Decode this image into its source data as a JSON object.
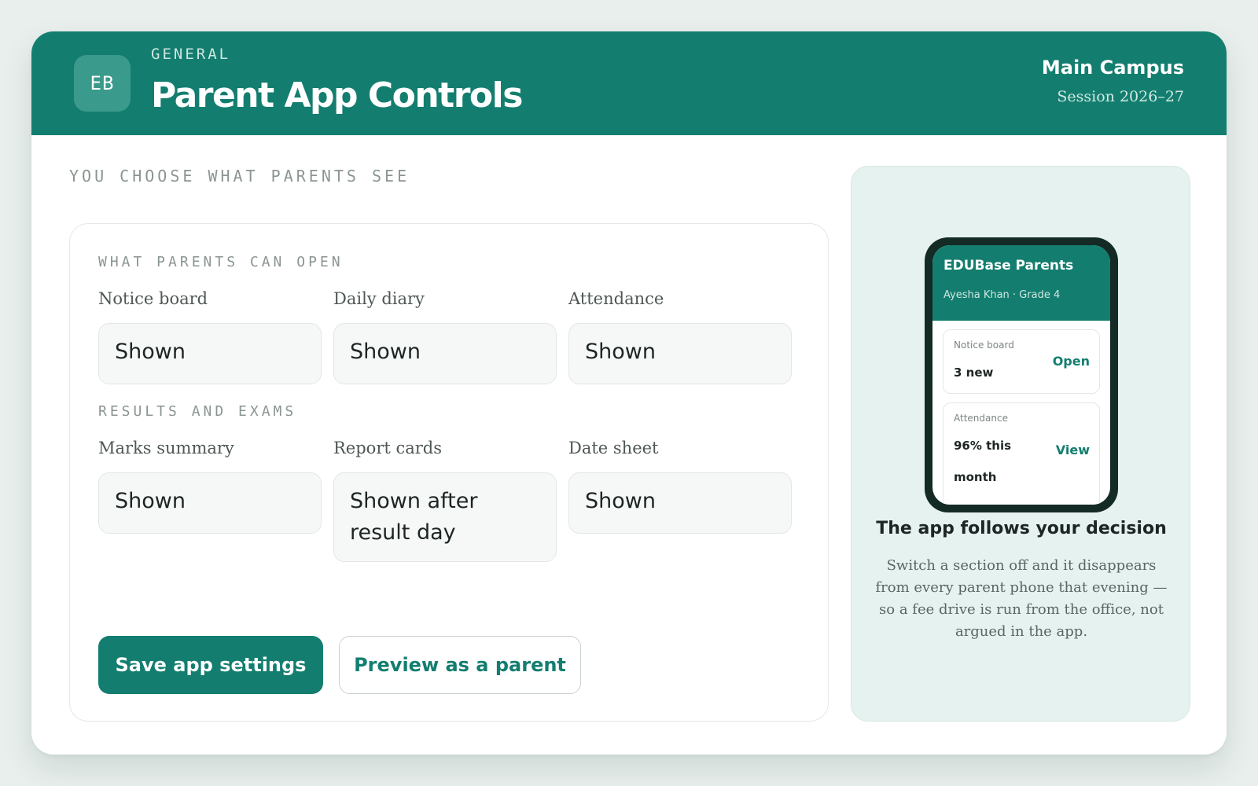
{
  "header": {
    "logo_initials": "EB",
    "eyebrow": "GENERAL",
    "title": "Parent App Controls",
    "campus": "Main Campus",
    "session": "Session 2026–27"
  },
  "main": {
    "kicker": "YOU CHOOSE WHAT PARENTS SEE",
    "sections": [
      {
        "label": "WHAT PARENTS CAN OPEN",
        "fields": [
          {
            "label": "Notice board",
            "value": "Shown"
          },
          {
            "label": "Daily diary",
            "value": "Shown"
          },
          {
            "label": "Attendance",
            "value": "Shown"
          }
        ]
      },
      {
        "label": "RESULTS AND EXAMS",
        "fields": [
          {
            "label": "Marks summary",
            "value": "Shown"
          },
          {
            "label": "Report cards",
            "value": "Shown after result day"
          },
          {
            "label": "Date sheet",
            "value": "Shown"
          }
        ]
      }
    ],
    "save_label": "Save app settings",
    "preview_label": "Preview as a parent"
  },
  "preview": {
    "app_name": "EDUBase Parents",
    "student": "Ayesha Khan · Grade 4",
    "cards": [
      {
        "label": "Notice board",
        "value": "3 new",
        "action": "Open"
      },
      {
        "label": "Attendance",
        "value": "96% this month",
        "action": "View"
      }
    ],
    "title": "The app follows your decision",
    "body": "Switch a section off and it disappears from every parent phone that evening — so a fee drive is run from the office, not argued in the app."
  },
  "colors": {
    "brand": "#137e6f",
    "background": "#e9efed",
    "side_panel": "#e6f2ef"
  }
}
